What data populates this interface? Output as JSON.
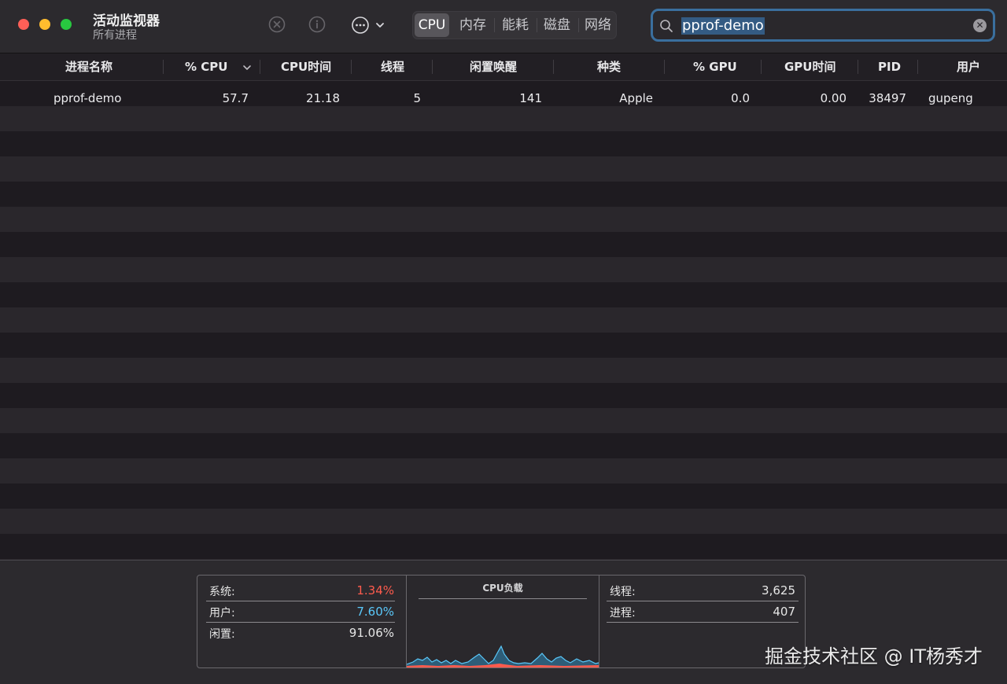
{
  "app": {
    "title": "活动监视器",
    "subtitle": "所有进程"
  },
  "toolbar": {
    "stop_icon": "xmark-circle-icon",
    "info_icon": "info-circle-icon",
    "more_icon": "ellipsis-circle-icon",
    "tabs": [
      {
        "label": "CPU",
        "active": true
      },
      {
        "label": "内存",
        "active": false
      },
      {
        "label": "能耗",
        "active": false
      },
      {
        "label": "磁盘",
        "active": false
      },
      {
        "label": "网络",
        "active": false
      }
    ]
  },
  "search": {
    "value": "pprof-demo",
    "focus_color": "#3a6f9e"
  },
  "table": {
    "columns": [
      "进程名称",
      "% CPU",
      "CPU时间",
      "线程",
      "闲置唤醒",
      "种类",
      "% GPU",
      "GPU时间",
      "PID",
      "用户"
    ],
    "sorted_column": "% CPU",
    "sort_direction": "descending",
    "rows": [
      {
        "name": "pprof-demo",
        "cpu": "57.7",
        "cpu_time": "21.18",
        "threads": "5",
        "idle_wakeups": "141",
        "kind": "Apple",
        "gpu": "0.0",
        "gpu_time": "0.00",
        "pid": "38497",
        "user": "gupeng"
      }
    ]
  },
  "summary": {
    "system_label": "系统:",
    "system_value": "1.34%",
    "system_color": "#ff5b4d",
    "user_label": "用户:",
    "user_value": "7.60%",
    "user_color": "#5ac8fa",
    "idle_label": "闲置:",
    "idle_value": "91.06%",
    "chart_title": "CPU负载",
    "threads_label": "线程:",
    "threads_value": "3,625",
    "processes_label": "进程:",
    "processes_value": "407"
  },
  "watermark": "掘金技术社区 @ IT杨秀才",
  "colors": {
    "window_bg": "#1e1b20",
    "row_stripe": "#2a272c",
    "close": "#ff5f57",
    "minimize": "#febc2e",
    "maximize": "#28c840"
  }
}
